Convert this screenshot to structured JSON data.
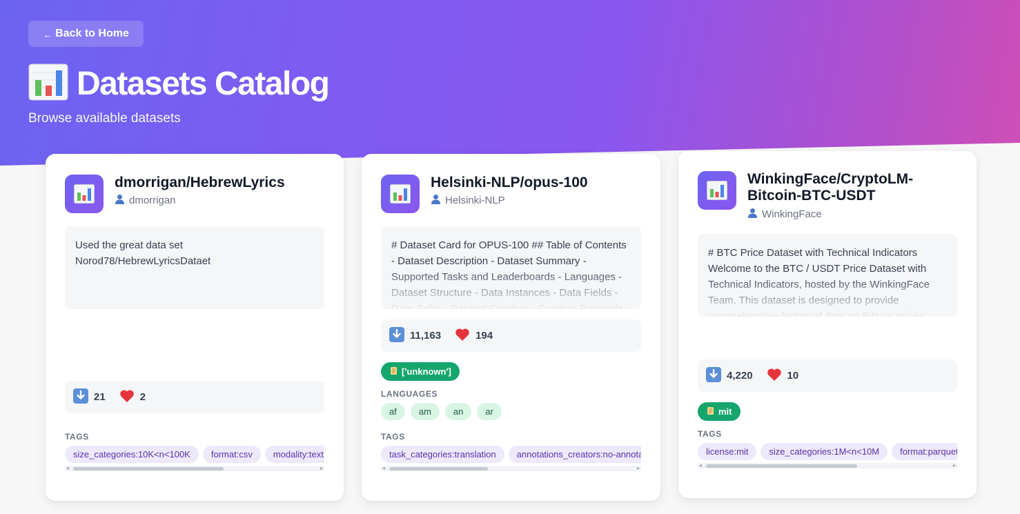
{
  "header": {
    "back_label": "Back to Home",
    "title": "Datasets Catalog",
    "subtitle": "Browse available datasets"
  },
  "cards": [
    {
      "title": "dmorrigan/HebrewLyrics",
      "author": "dmorrigan",
      "description": "Used the great data set Norod78/HebrewLyricsDataet",
      "downloads": "21",
      "likes": "2",
      "tags_label": "TAGS",
      "tags": [
        "size_categories:10K<n<100K",
        "format:csv",
        "modality:text"
      ]
    },
    {
      "title": "Helsinki-NLP/opus-100",
      "author": "Helsinki-NLP",
      "description": "# Dataset Card for OPUS-100 ## Table of Contents - Dataset Description - Dataset Summary - Supported Tasks and Leaderboards - Languages - Dataset Structure - Data Instances - Data Fields - Data Splits - Dataset Creation - Curation Rationale - Source Data",
      "downloads": "11,163",
      "likes": "194",
      "license": "['unknown']",
      "languages_label": "LANGUAGES",
      "languages": [
        "af",
        "am",
        "an",
        "ar"
      ],
      "tags_label": "TAGS",
      "tags": [
        "task_categories:translation",
        "annotations_creators:no-annotation"
      ]
    },
    {
      "title": "WinkingFace/CryptoLM-Bitcoin-BTC-USDT",
      "author": "WinkingFace",
      "description": "# BTC Price Dataset with Technical Indicators Welcome to the BTC / USDT Price Dataset with Technical Indicators, hosted by the WinkingFace Team. This dataset is designed to provide comprehensive historical data on Bitcoin prices along",
      "downloads": "4,220",
      "likes": "10",
      "license": "mit",
      "tags_label": "TAGS",
      "tags": [
        "license:mit",
        "size_categories:1M<n<10M",
        "format:parquet"
      ]
    }
  ],
  "icons": {
    "card": "bar-chart-icon",
    "author": "user-icon",
    "downloads": "download-arrow-icon",
    "likes": "heart-icon",
    "license": "scroll-icon"
  },
  "colors": {
    "hero_start": "#6d63f1",
    "hero_end": "#cf4fb6",
    "license_badge": "#15a66d",
    "tag_bg": "#ede9fb",
    "language_bg": "#d9f5e4"
  }
}
